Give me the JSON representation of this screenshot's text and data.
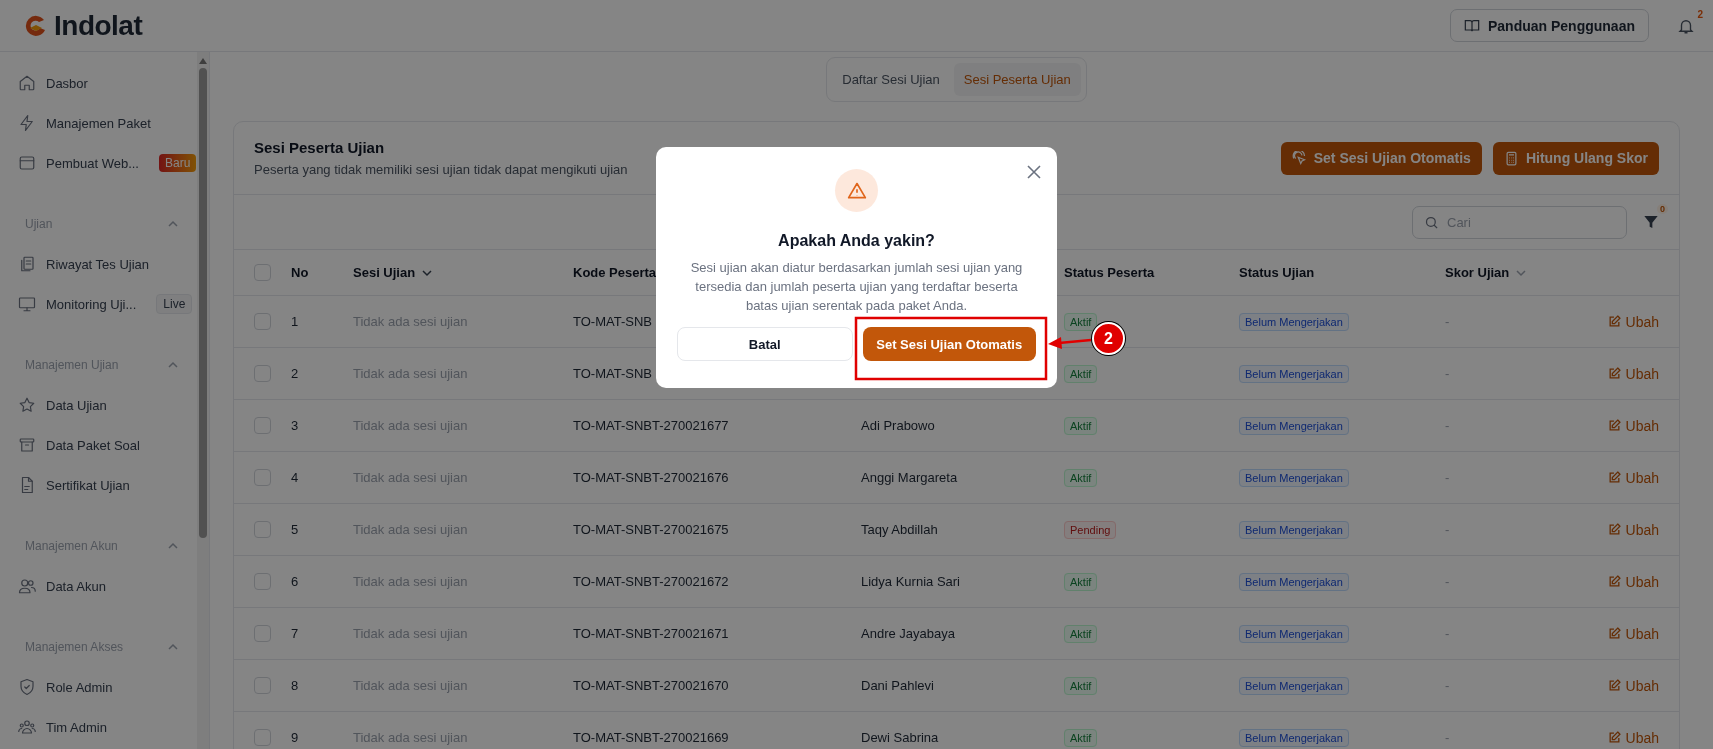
{
  "header": {
    "logo": "Indolat",
    "guide_button": "Panduan Penggunaan",
    "notification_count": "2"
  },
  "sidebar": {
    "items": [
      {
        "label": "Dasbor"
      },
      {
        "label": "Manajemen Paket"
      },
      {
        "label": "Pembuat Web...",
        "badge": {
          "text": "Baru",
          "kind": "new"
        }
      }
    ],
    "sections": [
      {
        "title": "Ujian",
        "expanded": true,
        "items": [
          {
            "label": "Riwayat Tes Ujian"
          },
          {
            "label": "Monitoring Uji...",
            "badge": {
              "text": "Live",
              "kind": "live"
            }
          }
        ]
      },
      {
        "title": "Manajemen Ujian",
        "expanded": true,
        "items": [
          {
            "label": "Data Ujian"
          },
          {
            "label": "Data Paket Soal"
          },
          {
            "label": "Sertifikat Ujian"
          }
        ]
      },
      {
        "title": "Manajemen Akun",
        "expanded": true,
        "items": [
          {
            "label": "Data Akun"
          }
        ]
      },
      {
        "title": "Manajemen Akses",
        "expanded": true,
        "items": [
          {
            "label": "Role Admin"
          },
          {
            "label": "Tim Admin"
          }
        ]
      }
    ]
  },
  "tabs": [
    {
      "label": "Daftar Sesi Ujian",
      "selected": false
    },
    {
      "label": "Sesi Peserta Ujian",
      "selected": true
    }
  ],
  "card": {
    "title": "Sesi Peserta Ujian",
    "subtitle": "Peserta yang tidak memiliki sesi ujian tidak dapat mengikuti ujian",
    "actions": [
      "Set Sesi Ujian Otomatis",
      "Hitung Ulang Skor"
    ],
    "search": {
      "placeholder": "Cari"
    },
    "filter_count": "0"
  },
  "table": {
    "select_all": {
      "checked": false
    },
    "columns": {
      "no": {
        "label": "No"
      },
      "session": {
        "label": "Sesi Ujian",
        "sort_active": true
      },
      "code": {
        "label": "Kode Peserta"
      },
      "participant_status": {
        "label": "Status Peserta"
      },
      "exam_status": {
        "label": "Status Ujian"
      },
      "score": {
        "label": "Skor Ujian",
        "sort_active": false
      }
    },
    "rows": [
      {
        "checked": false,
        "no": "1",
        "session": "Tidak ada sesi ujian",
        "code": "TO-MAT-SNB",
        "participant_status": {
          "text": "Aktif",
          "kind": "success"
        },
        "exam_status": {
          "text": "Belum Mengerjakan",
          "kind": "info"
        },
        "score": "-",
        "action": "Ubah"
      },
      {
        "checked": false,
        "no": "2",
        "session": "Tidak ada sesi ujian",
        "code": "TO-MAT-SNB",
        "participant_status": {
          "text": "Aktif",
          "kind": "success"
        },
        "exam_status": {
          "text": "Belum Mengerjakan",
          "kind": "info"
        },
        "score": "-",
        "action": "Ubah"
      },
      {
        "checked": false,
        "no": "3",
        "session": "Tidak ada sesi ujian",
        "code": "TO-MAT-SNBT-270021677",
        "name": "Adi Prabowo",
        "participant_status": {
          "text": "Aktif",
          "kind": "success"
        },
        "exam_status": {
          "text": "Belum Mengerjakan",
          "kind": "info"
        },
        "score": "-",
        "action": "Ubah"
      },
      {
        "checked": false,
        "no": "4",
        "session": "Tidak ada sesi ujian",
        "code": "TO-MAT-SNBT-270021676",
        "name": "Anggi Margareta",
        "participant_status": {
          "text": "Aktif",
          "kind": "success"
        },
        "exam_status": {
          "text": "Belum Mengerjakan",
          "kind": "info"
        },
        "score": "-",
        "action": "Ubah"
      },
      {
        "checked": false,
        "no": "5",
        "session": "Tidak ada sesi ujian",
        "code": "TO-MAT-SNBT-270021675",
        "name": "Taqy Abdillah",
        "participant_status": {
          "text": "Pending",
          "kind": "danger"
        },
        "exam_status": {
          "text": "Belum Mengerjakan",
          "kind": "info"
        },
        "score": "-",
        "action": "Ubah"
      },
      {
        "checked": false,
        "no": "6",
        "session": "Tidak ada sesi ujian",
        "code": "TO-MAT-SNBT-270021672",
        "name": "Lidya Kurnia Sari",
        "participant_status": {
          "text": "Aktif",
          "kind": "success"
        },
        "exam_status": {
          "text": "Belum Mengerjakan",
          "kind": "info"
        },
        "score": "-",
        "action": "Ubah"
      },
      {
        "checked": false,
        "no": "7",
        "session": "Tidak ada sesi ujian",
        "code": "TO-MAT-SNBT-270021671",
        "name": "Andre Jayabaya",
        "participant_status": {
          "text": "Aktif",
          "kind": "success"
        },
        "exam_status": {
          "text": "Belum Mengerjakan",
          "kind": "info"
        },
        "score": "-",
        "action": "Ubah"
      },
      {
        "checked": false,
        "no": "8",
        "session": "Tidak ada sesi ujian",
        "code": "TO-MAT-SNBT-270021670",
        "name": "Dani Pahlevi",
        "participant_status": {
          "text": "Aktif",
          "kind": "success"
        },
        "exam_status": {
          "text": "Belum Mengerjakan",
          "kind": "info"
        },
        "score": "-",
        "action": "Ubah"
      },
      {
        "checked": false,
        "no": "9",
        "session": "Tidak ada sesi ujian",
        "code": "TO-MAT-SNBT-270021669",
        "name": "Dewi Sabrina",
        "participant_status": {
          "text": "Aktif",
          "kind": "success"
        },
        "exam_status": {
          "text": "Belum Mengerjakan",
          "kind": "info"
        },
        "score": "-",
        "action": "Ubah"
      }
    ]
  },
  "dialog": {
    "title": "Apakah Anda yakin?",
    "message": "Sesi ujian akan diatur berdasarkan jumlah sesi ujian yang tersedia dan jumlah peserta ujian yang terdaftar beserta batas ujian serentak pada paket Anda.",
    "cancel": "Batal",
    "confirm": "Set Sesi Ujian Otomatis"
  },
  "annotation": {
    "label": "2"
  }
}
